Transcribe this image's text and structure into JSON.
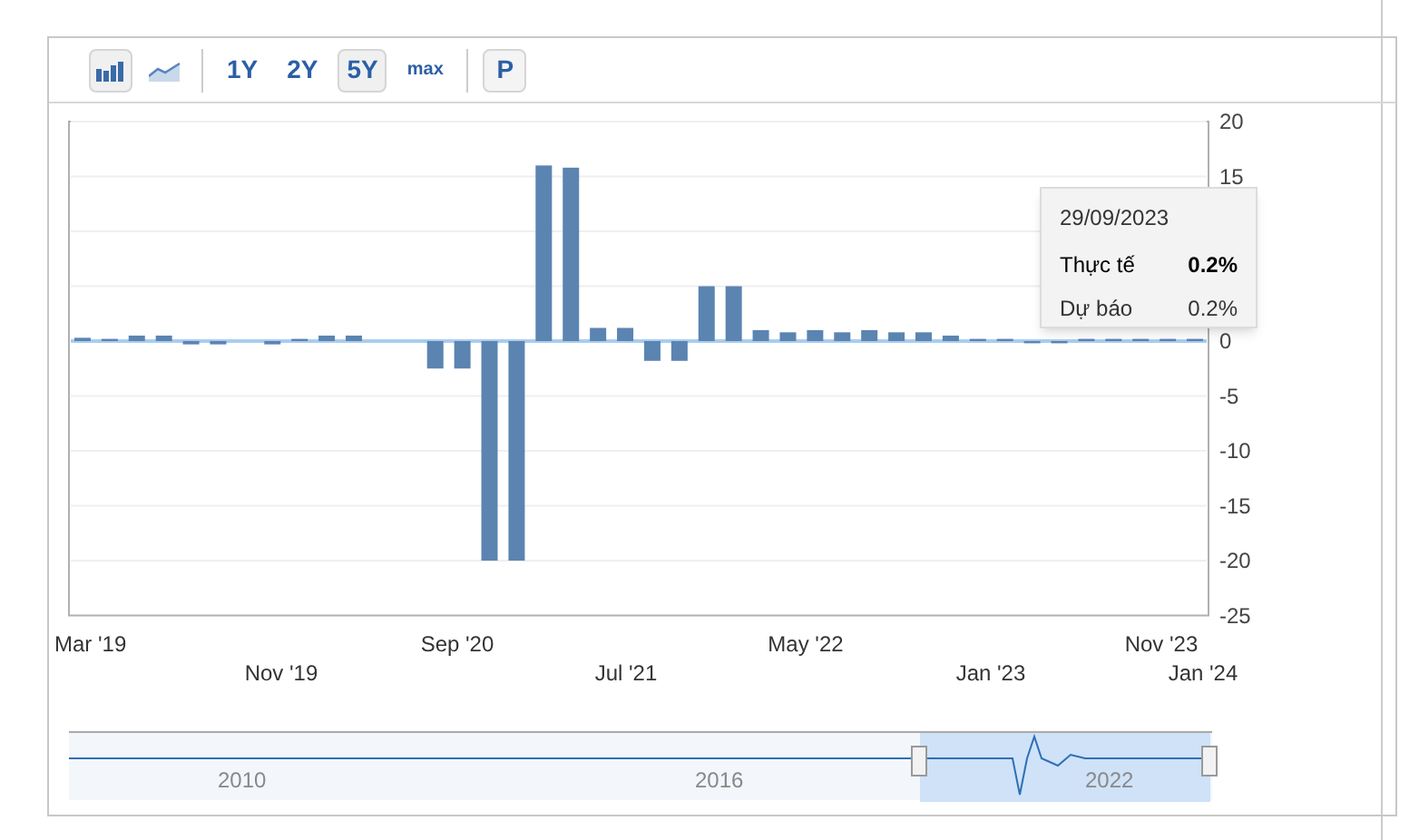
{
  "toolbar": [
    {
      "kind": "bar-icon",
      "selected": true
    },
    {
      "kind": "line-icon",
      "selected": false
    },
    {
      "kind": "text",
      "label": "1Y",
      "selected": false
    },
    {
      "kind": "text",
      "label": "2Y",
      "selected": false
    },
    {
      "kind": "text",
      "label": "5Y",
      "selected": true
    },
    {
      "kind": "small",
      "label": "max",
      "selected": false
    },
    {
      "kind": "boxed",
      "label": "P",
      "selected": false
    }
  ],
  "chart": {
    "chart_data": {
      "type": "bar",
      "values": [
        0.3,
        0.2,
        0.5,
        0.5,
        -0.3,
        -0.3,
        null,
        -0.3,
        0.2,
        0.5,
        0.5,
        null,
        null,
        -2.5,
        -2.5,
        -20,
        -20,
        16,
        15.8,
        1.2,
        1.2,
        -1.8,
        -1.8,
        5,
        5,
        1,
        0.8,
        1,
        0.8,
        1,
        0.8,
        0.8,
        0.5,
        0.2,
        0.2,
        -0.2,
        -0.2,
        0.2,
        0.2,
        0.2,
        0.2,
        0.2
      ],
      "ylim": [
        -25,
        20
      ],
      "yticks": [
        20,
        15,
        0,
        -5,
        -10,
        -15,
        -20,
        -25
      ],
      "grid": true,
      "ref_lines": [
        {
          "axis": "y",
          "value": 0,
          "color": "#a9cdf0"
        }
      ]
    },
    "x_labels": [
      "Mar '19",
      "Nov '19",
      "Sep '20",
      "Jul '21",
      "May '22",
      "Jan '23",
      "Nov '23",
      "Jan '24"
    ],
    "tooltip": {
      "date": "29/09/2023",
      "rows": [
        {
          "label": "Thực tế",
          "value": "0.2%",
          "bold": true
        },
        {
          "label": "Dự báo",
          "value": "0.2%",
          "bold": false
        }
      ]
    }
  },
  "navigator": {
    "labels": [
      "2010",
      "2016",
      "2022"
    ]
  }
}
